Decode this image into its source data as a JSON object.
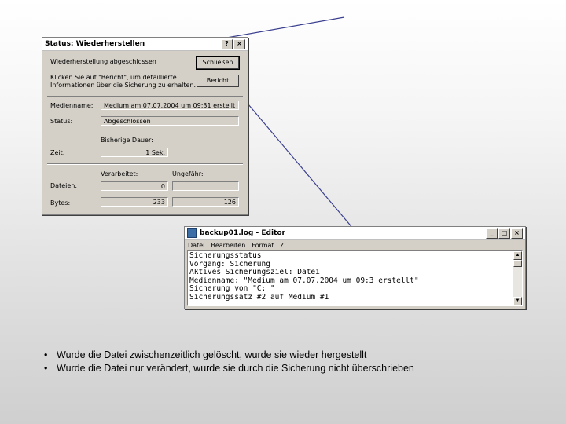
{
  "status_dialog": {
    "title": "Status: Wiederherstellen",
    "help_btn": "?",
    "close_btn": "×",
    "message": "Wiederherstellung abgeschlossen",
    "info_line1": "Klicken Sie auf \"Bericht\", um detaillierte",
    "info_line2": "Informationen über die Sicherung zu erhalten.",
    "close_button": "Schließen",
    "report_button": "Bericht",
    "medium_label": "Medienname:",
    "medium_value": "Medium am 07.07.2004 um 09:31 erstellt",
    "status_label": "Status:",
    "status_value": "Abgeschlossen",
    "elapsed_header": "Bisherige Dauer:",
    "time_label": "Zeit:",
    "time_value": "1 Sek.",
    "processed_header": "Verarbeitet:",
    "estimated_header": "Ungefähr:",
    "files_label": "Dateien:",
    "files_processed": "0",
    "files_estimated": "",
    "bytes_label": "Bytes:",
    "bytes_processed": "233",
    "bytes_estimated": "126"
  },
  "notepad": {
    "title_file": "backup01.log",
    "title_app": "- Editor",
    "menu": [
      "Datei",
      "Bearbeiten",
      "Format",
      "?"
    ],
    "lines": [
      "Sicherungsstatus",
      "Vorgang: Sicherung",
      "Aktives Sicherungsziel: Datei",
      "Medienname: \"Medium am 07.07.2004 um 09:3 erstellt\"",
      "Sicherung von \"C: \"",
      "Sicherungssatz #2 auf Medium #1"
    ],
    "min_btn": "_",
    "max_btn": "□",
    "close_btn": "×"
  },
  "bullets": [
    "Wurde die Datei zwischenzeitlich gelöscht, wurde sie wieder hergestellt",
    "Wurde die Datei nur verändert, wurde sie durch die Sicherung nicht überschrieben"
  ],
  "colors": {
    "arrow": "#3a3f8f"
  }
}
